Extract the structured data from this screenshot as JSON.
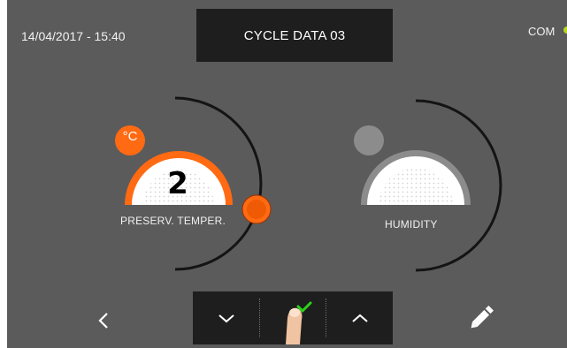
{
  "status_bar": {
    "datetime": "14/04/2017 - 15:40",
    "com_label": "COM",
    "com_color": "#b7d81f"
  },
  "header": {
    "title": "CYCLE DATA 03"
  },
  "gauges": {
    "temperature": {
      "label": "PRESERV. TEMPER.",
      "value": "2",
      "unit": "°C",
      "accent_color": "#ff6a13"
    },
    "humidity": {
      "label": "HUMIDITY",
      "accent_color": "#8c8c8c"
    }
  },
  "nav": {
    "back_icon": "chevron-left-icon",
    "down_icon": "chevron-down-icon",
    "confirm_icon": "check-icon",
    "up_icon": "chevron-up-icon",
    "edit_icon": "pencil-icon",
    "confirm_color": "#2bd31b"
  },
  "colors": {
    "background": "#5b5b5b",
    "panel": "#1e1e1e"
  }
}
